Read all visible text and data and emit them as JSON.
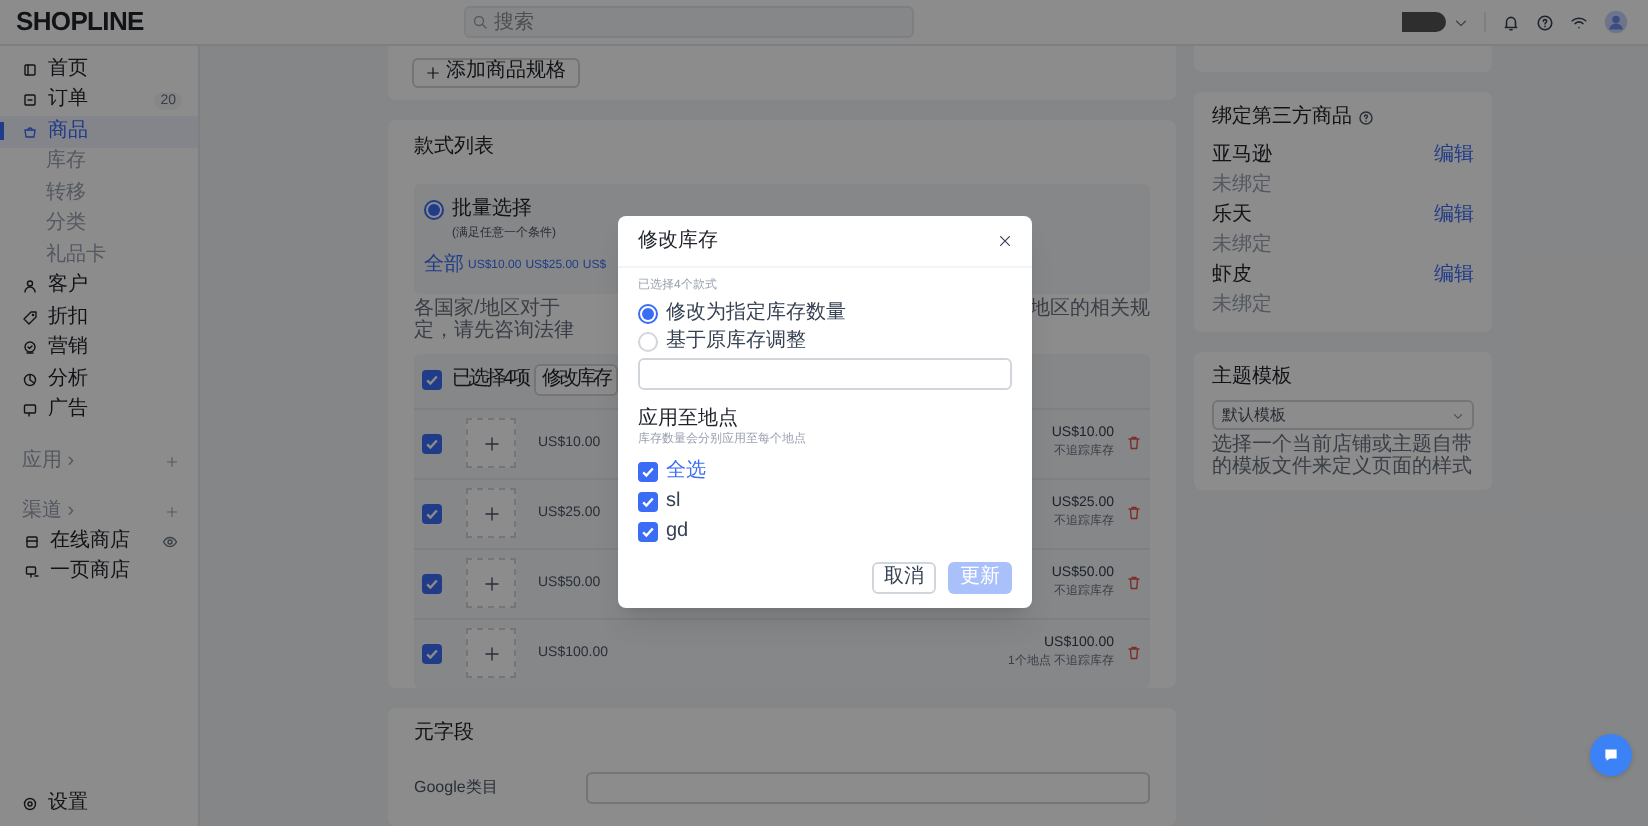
{
  "topbar": {
    "logo": "SHOPLINE",
    "search": {
      "placeholder": "搜索"
    }
  },
  "sidebar": {
    "items": [
      {
        "label": "首页",
        "selected": false
      },
      {
        "label": "订单",
        "badge": "20",
        "selected": false
      },
      {
        "label": "商品",
        "selected": true,
        "children": [
          {
            "label": "库存",
            "selected": false
          },
          {
            "label": "转移",
            "selected": false
          },
          {
            "label": "分类",
            "selected": false
          },
          {
            "label": "礼品卡",
            "selected": false
          }
        ]
      },
      {
        "label": "客户",
        "selected": false
      },
      {
        "label": "折扣",
        "selected": false
      },
      {
        "label": "营销",
        "selected": false
      },
      {
        "label": "分析",
        "selected": false
      },
      {
        "label": "广告",
        "selected": false
      }
    ],
    "sections": [
      {
        "title": "应用 ›"
      },
      {
        "title": "渠道 ›",
        "items": [
          {
            "label": "在线商店",
            "selected": false
          },
          {
            "label": "一页商店",
            "selected": false
          }
        ]
      }
    ],
    "settings": {
      "label": "设置"
    }
  },
  "product_options": {
    "add_button": "添加商品规格"
  },
  "variant_list": {
    "title": "款式列表",
    "filter": {
      "label": "批量选择",
      "hint": "(满足任意一个条件)",
      "selected": true,
      "chips": [
        "全部",
        "US$10.00",
        "US$25.00",
        "US$"
      ]
    },
    "notice": {
      "left": [
        "各国家/地区对于",
        "定，请先咨询法律"
      ],
      "right": [
        "地区的相关规"
      ]
    },
    "bulk_bar": {
      "checked": true,
      "label": "已选择4项",
      "button": "修改库存"
    },
    "rows": [
      {
        "checked": true,
        "price": "US$10.00",
        "total": "US$10.00",
        "note": "不追踪库存"
      },
      {
        "checked": true,
        "price": "US$25.00",
        "total": "US$25.00",
        "note": "不追踪库存"
      },
      {
        "checked": true,
        "price": "US$50.00",
        "total": "US$50.00",
        "note": "不追踪库存"
      },
      {
        "checked": true,
        "price": "US$100.00",
        "total": "US$100.00",
        "note": "1个地点 不追踪库存"
      }
    ]
  },
  "metafields": {
    "title": "元字段",
    "fields": [
      {
        "label": "Google类目"
      }
    ]
  },
  "third_party": {
    "title": "绑定第三方商品",
    "platforms": [
      {
        "name": "亚马逊",
        "action": "编辑",
        "status": "未绑定"
      },
      {
        "name": "乐天",
        "action": "编辑",
        "status": "未绑定"
      },
      {
        "name": "虾皮",
        "action": "编辑",
        "status": "未绑定"
      }
    ]
  },
  "theme_template": {
    "title": "主题模板",
    "select": {
      "value": "默认模板"
    },
    "help": "选择一个当前店铺或主题自带的模板文件来定义页面的样式"
  },
  "modal": {
    "title": "修改库存",
    "selected_count": "已选择4个款式",
    "modes": [
      {
        "label": "修改为指定库存数量",
        "selected": true
      },
      {
        "label": "基于原库存调整",
        "selected": false
      }
    ],
    "locations": {
      "title": "应用至地点",
      "hint": "库存数量会分别应用至每个地点",
      "options": [
        {
          "label": "全选",
          "kind": "select_all",
          "checked": true
        },
        {
          "label": "sl",
          "kind": "location",
          "checked": true
        },
        {
          "label": "gd",
          "kind": "location",
          "checked": true
        }
      ]
    },
    "buttons": [
      {
        "label": "取消",
        "kind": "secondary",
        "disabled": false
      },
      {
        "label": "更新",
        "kind": "primary",
        "disabled": true
      }
    ]
  }
}
